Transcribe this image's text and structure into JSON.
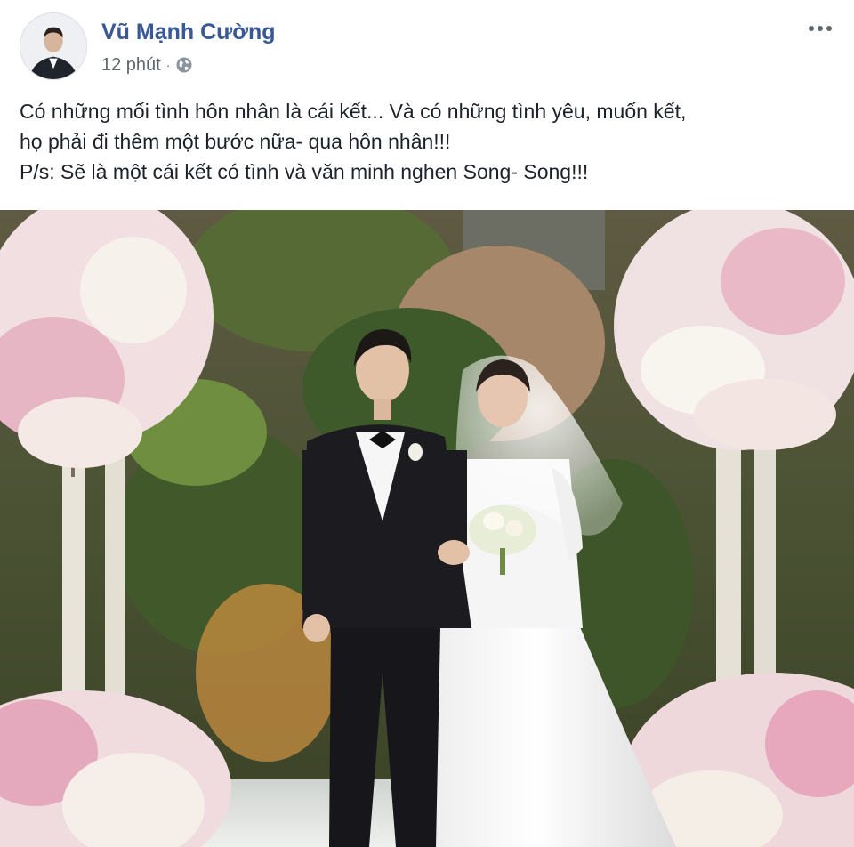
{
  "post": {
    "author": "Vũ Mạnh Cường",
    "time": "12 phút",
    "separator": "·",
    "privacy_icon": "globe-icon",
    "more_icon": "more-options-icon",
    "text_lines": [
      "Có những mối tình hôn nhân là cái kết... Và có những tình yêu, muốn kết,",
      "họ phải đi thêm một bước nữa- qua hôn nhân!!!",
      "P/s: Sẽ là một cái kết có tình và văn minh nghen Song- Song!!!"
    ],
    "photo_description_icon": "wedding-photo"
  },
  "colors": {
    "author_link": "#385898",
    "meta_text": "#606770",
    "body_text": "#1d2129"
  }
}
